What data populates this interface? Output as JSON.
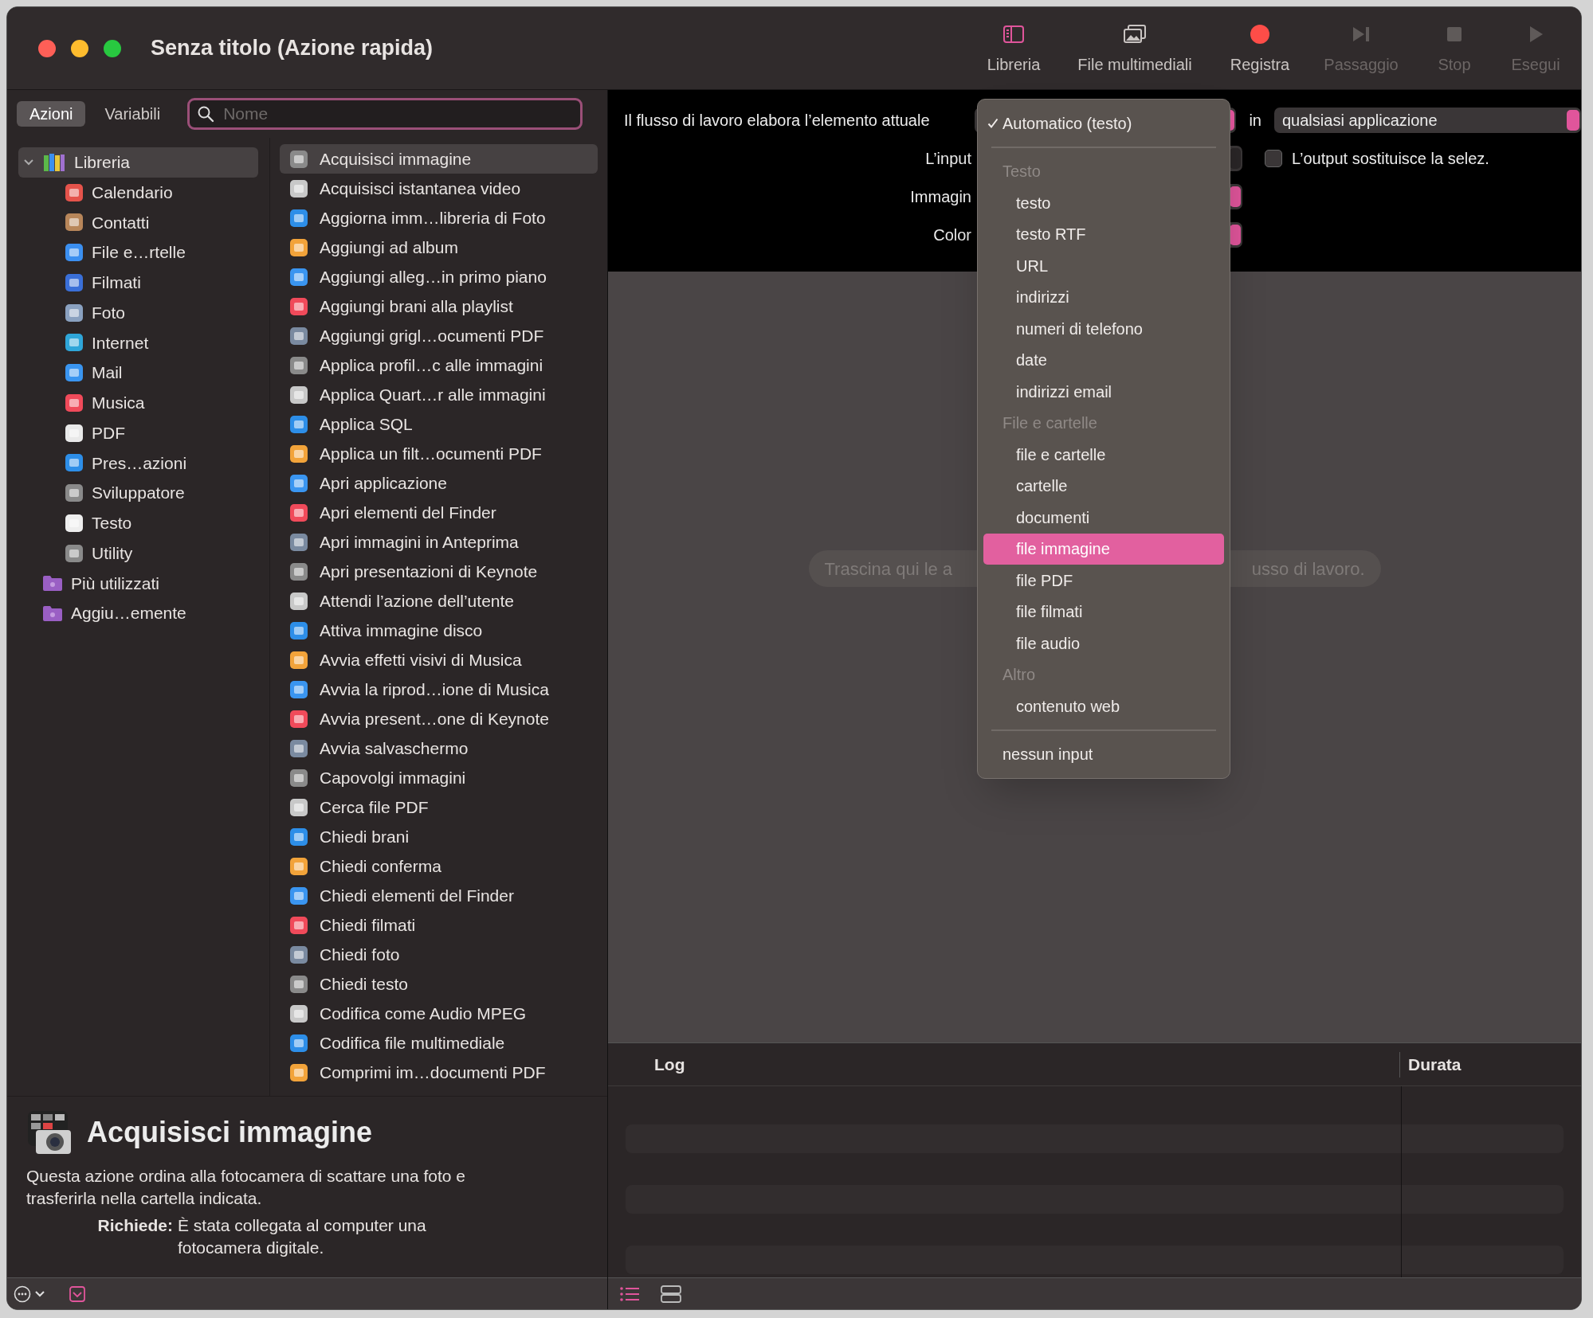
{
  "window": {
    "title": "Senza titolo (Azione rapida)"
  },
  "toolbar": [
    {
      "label": "Libreria",
      "on": true,
      "disabled": false
    },
    {
      "label": "File multimediali",
      "on": false,
      "disabled": false
    },
    {
      "label": "Registra",
      "disabled": false
    },
    {
      "label": "Passaggio",
      "disabled": true
    },
    {
      "label": "Stop",
      "disabled": true
    },
    {
      "label": "Esegui",
      "disabled": true
    }
  ],
  "sidebar": {
    "tabs": [
      {
        "label": "Azioni",
        "selected": true
      },
      {
        "label": "Variabili",
        "selected": false
      }
    ],
    "search": {
      "placeholder": "Nome"
    },
    "library": [
      {
        "label": "Libreria",
        "selected": true,
        "expanded": true,
        "children": [
          {
            "label": "Calendario",
            "selected": false
          },
          {
            "label": "Contatti",
            "selected": false
          },
          {
            "label": "File e…rtelle",
            "selected": false
          },
          {
            "label": "Filmati",
            "selected": false
          },
          {
            "label": "Foto",
            "selected": false
          },
          {
            "label": "Internet",
            "selected": false
          },
          {
            "label": "Mail",
            "selected": false
          },
          {
            "label": "Musica",
            "selected": false
          },
          {
            "label": "PDF",
            "selected": false
          },
          {
            "label": "Pres…azioni",
            "selected": false
          },
          {
            "label": "Sviluppatore",
            "selected": false
          },
          {
            "label": "Testo",
            "selected": false
          },
          {
            "label": "Utility",
            "selected": false
          }
        ]
      },
      {
        "label": "Più utilizzati",
        "selected": false
      },
      {
        "label": "Aggiu…emente",
        "selected": false
      }
    ],
    "actions": [
      {
        "label": "Acquisisci immagine",
        "selected": true
      },
      {
        "label": "Acquisisci istantanea video",
        "selected": false
      },
      {
        "label": "Aggiorna imm…libreria di Foto",
        "selected": false
      },
      {
        "label": "Aggiungi ad album",
        "selected": false
      },
      {
        "label": "Aggiungi alleg…in primo piano",
        "selected": false
      },
      {
        "label": "Aggiungi brani alla playlist",
        "selected": false
      },
      {
        "label": "Aggiungi grigl…ocumenti PDF",
        "selected": false
      },
      {
        "label": "Applica profil…c alle immagini",
        "selected": false
      },
      {
        "label": "Applica Quart…r alle immagini",
        "selected": false
      },
      {
        "label": "Applica SQL",
        "selected": false
      },
      {
        "label": "Applica un filt…ocumenti PDF",
        "selected": false
      },
      {
        "label": "Apri applicazione",
        "selected": false
      },
      {
        "label": "Apri elementi del Finder",
        "selected": false
      },
      {
        "label": "Apri immagini in Anteprima",
        "selected": false
      },
      {
        "label": "Apri presentazioni di Keynote",
        "selected": false
      },
      {
        "label": "Attendi l’azione dell’utente",
        "selected": false
      },
      {
        "label": "Attiva immagine disco",
        "selected": false
      },
      {
        "label": "Avvia effetti visivi di Musica",
        "selected": false
      },
      {
        "label": "Avvia la riprod…ione di Musica",
        "selected": false
      },
      {
        "label": "Avvia present…one di Keynote",
        "selected": false
      },
      {
        "label": "Avvia salvaschermo",
        "selected": false
      },
      {
        "label": "Capovolgi immagini",
        "selected": false
      },
      {
        "label": "Cerca file PDF",
        "selected": false
      },
      {
        "label": "Chiedi brani",
        "selected": false
      },
      {
        "label": "Chiedi conferma",
        "selected": false
      },
      {
        "label": "Chiedi elementi del Finder",
        "selected": false
      },
      {
        "label": "Chiedi filmati",
        "selected": false
      },
      {
        "label": "Chiedi foto",
        "selected": false
      },
      {
        "label": "Chiedi testo",
        "selected": false
      },
      {
        "label": "Codifica come Audio MPEG",
        "selected": false
      },
      {
        "label": "Codifica file multimediale",
        "selected": false
      },
      {
        "label": "Comprimi im…documenti PDF",
        "selected": false
      }
    ],
    "description": {
      "title": "Acquisisci immagine",
      "text": "Questa azione ordina alla fotocamera di scattare una foto e trasferirla nella cartella indicata.",
      "requires_label": "Richiede:",
      "requires_text": "È stata collegata al computer una fotocamera digitale."
    }
  },
  "workflow": {
    "input_row": {
      "label": "Il flusso di lavoro elabora l’elemento attuale",
      "in_label": "in",
      "application": "qualsiasi applicazione"
    },
    "option_rows": [
      {
        "label": "L’input",
        "disabled": true,
        "checkbox_label": "L’output sostituisce la selez.",
        "checked": false
      },
      {
        "label": "Immagin",
        "disabled": false
      },
      {
        "label": "Color",
        "disabled": false
      }
    ],
    "hint_left": "Trascina qui le a",
    "hint_right": "usso di lavoro."
  },
  "menu": [
    {
      "kind": "item",
      "label": "Automatico (testo)",
      "checked": true,
      "selected": false
    },
    {
      "kind": "separator"
    },
    {
      "kind": "header",
      "label": "Testo"
    },
    {
      "kind": "option",
      "label": "testo",
      "checked": false,
      "selected": false
    },
    {
      "kind": "option",
      "label": "testo RTF",
      "checked": false,
      "selected": false
    },
    {
      "kind": "option",
      "label": "URL",
      "checked": false,
      "selected": false
    },
    {
      "kind": "option",
      "label": "indirizzi",
      "checked": false,
      "selected": false
    },
    {
      "kind": "option",
      "label": "numeri di telefono",
      "checked": false,
      "selected": false
    },
    {
      "kind": "option",
      "label": "date",
      "checked": false,
      "selected": false
    },
    {
      "kind": "option",
      "label": "indirizzi email",
      "checked": false,
      "selected": false
    },
    {
      "kind": "header",
      "label": "File e cartelle"
    },
    {
      "kind": "option",
      "label": "file e cartelle",
      "checked": false,
      "selected": false
    },
    {
      "kind": "option",
      "label": "cartelle",
      "checked": false,
      "selected": false
    },
    {
      "kind": "option",
      "label": "documenti",
      "checked": false,
      "selected": false
    },
    {
      "kind": "option",
      "label": "file immagine",
      "checked": false,
      "selected": true
    },
    {
      "kind": "option",
      "label": "file PDF",
      "checked": false,
      "selected": false
    },
    {
      "kind": "option",
      "label": "file filmati",
      "checked": false,
      "selected": false
    },
    {
      "kind": "option",
      "label": "file audio",
      "checked": false,
      "selected": false
    },
    {
      "kind": "header",
      "label": "Altro"
    },
    {
      "kind": "option",
      "label": "contenuto web",
      "checked": false,
      "selected": false
    },
    {
      "kind": "separator"
    },
    {
      "kind": "item",
      "label": "nessun input",
      "checked": false,
      "selected": false
    }
  ],
  "log": {
    "columns": [
      "Log",
      "Durata"
    ]
  }
}
